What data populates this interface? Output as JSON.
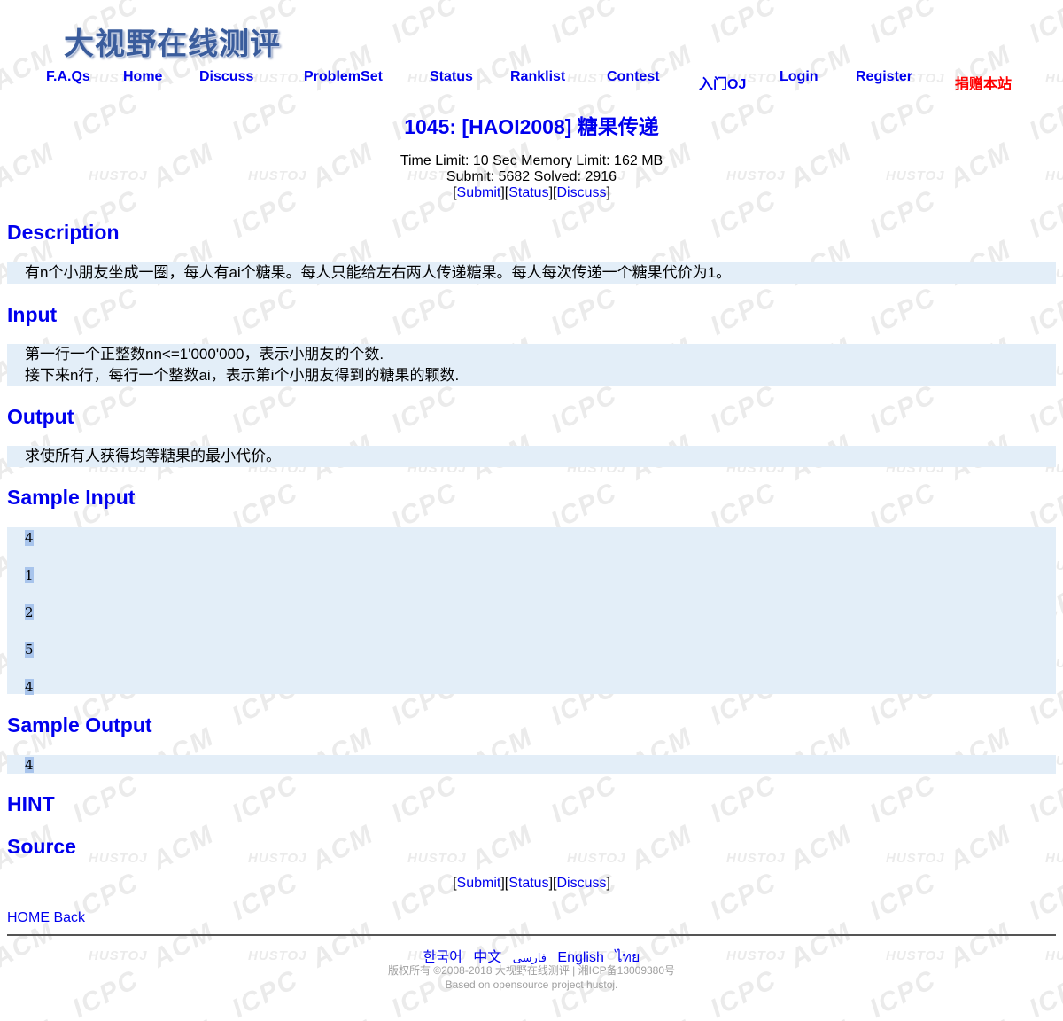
{
  "logo": {
    "text": "大视野在线测评"
  },
  "nav": [
    {
      "label": "F.A.Qs"
    },
    {
      "label": "Home"
    },
    {
      "label": "Discuss"
    },
    {
      "label": "ProblemSet"
    },
    {
      "label": "Status"
    },
    {
      "label": "Ranklist"
    },
    {
      "label": "Contest"
    },
    {
      "label": "入门OJ"
    },
    {
      "label": "Login"
    },
    {
      "label": "Register"
    },
    {
      "label": "捐赠本站",
      "color": "#ff0000"
    }
  ],
  "problem": {
    "title": "1045: [HAOI2008] 糖果传递",
    "time_limit": "Time Limit: 10 Sec  Memory Limit: 162 MB",
    "submit_solved": "Submit: 5682  Solved: 2916",
    "links": {
      "submit": "Submit",
      "status": "Status",
      "discuss": "Discuss"
    }
  },
  "sections": {
    "description": {
      "heading": "Description",
      "text": "有n个小朋友坐成一圈，每人有ai个糖果。每人只能给左右两人传递糖果。每人每次传递一个糖果代价为1。"
    },
    "input": {
      "heading": "Input",
      "line1": "第一行一个正整数nn<=1'000'000，表示小朋友的个数.",
      "line2": "接下来n行，每行一个整数ai，表示第i个小朋友得到的糖果的颗数."
    },
    "output": {
      "heading": "Output",
      "text": "求使所有人获得均等糖果的最小代价。"
    },
    "sample_input": {
      "heading": "Sample Input",
      "lines": [
        "4",
        "1",
        "2",
        "5",
        "4"
      ]
    },
    "sample_output": {
      "heading": "Sample Output",
      "lines": [
        "4"
      ]
    },
    "hint": {
      "heading": "HINT"
    },
    "source": {
      "heading": "Source"
    }
  },
  "footer": {
    "home": "HOME",
    "back": "Back",
    "languages": [
      "한국어",
      "中文",
      "فارسی",
      "English",
      "ไทย"
    ],
    "copyright": "版权所有 ©2008-2018 大视野在线测评 | 湘ICP备13009380号",
    "based_on": "Based on opensource project hustoj."
  },
  "colors": {
    "link": "#0000ee",
    "donate": "#ff0000",
    "box": "#e3eef8"
  },
  "watermark": {
    "text_big_1": "ACM",
    "text_big_2": "ICPC",
    "text_small": "HUSTOJ"
  }
}
